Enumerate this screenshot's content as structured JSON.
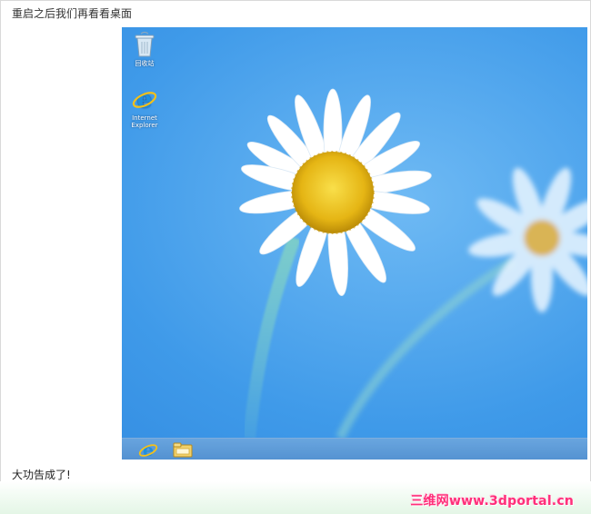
{
  "captions": {
    "top": "重启之后我们再看看桌面",
    "bottom": "大功告成了!"
  },
  "desktop": {
    "icons": [
      {
        "label": "回收站",
        "icon": "recycle-bin-icon"
      },
      {
        "label_line1": "Internet",
        "label_line2": "Explorer",
        "icon": "internet-explorer-icon"
      }
    ],
    "wallpaper": "daisy-on-blue",
    "colors": {
      "sky": "#3f9ae9",
      "petal": "#ffffff",
      "center": "#f1c21b"
    }
  },
  "taskbar": {
    "items": [
      {
        "icon": "internet-explorer-icon"
      },
      {
        "icon": "file-explorer-icon"
      }
    ]
  },
  "watermark": {
    "text": "三维网www.3dportal.cn",
    "color": "#ff2f7a"
  }
}
